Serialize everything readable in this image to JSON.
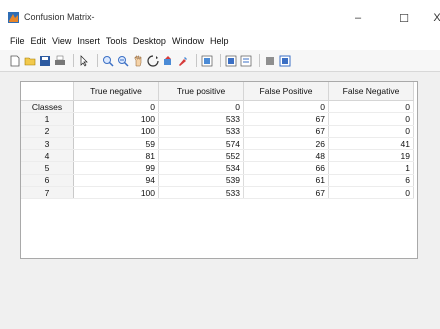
{
  "window": {
    "title": "Confusion Matrix-",
    "minimize": "–",
    "maximize": "☐",
    "close": "X"
  },
  "menu": [
    "File",
    "Edit",
    "View",
    "Insert",
    "Tools",
    "Desktop",
    "Window",
    "Help"
  ],
  "toolbar_icons": [
    "new-figure-icon",
    "open-file-icon",
    "save-icon",
    "print-icon",
    "pointer-icon",
    "zoom-in-icon",
    "zoom-out-icon",
    "pan-icon",
    "rotate-icon",
    "data-cursor-icon",
    "brush-icon",
    "link-plot-icon",
    "colorbar-icon",
    "legend-icon",
    "hide-plot-tools-icon",
    "show-plot-tools-icon"
  ],
  "table": {
    "columns": [
      "True negative",
      "True positive",
      "False Positive",
      "False Negative"
    ],
    "rows": [
      {
        "label": "Classes",
        "values": [
          "0",
          "0",
          "0",
          "0"
        ]
      },
      {
        "label": "1",
        "values": [
          "100",
          "533",
          "67",
          "0"
        ]
      },
      {
        "label": "2",
        "values": [
          "100",
          "533",
          "67",
          "0"
        ]
      },
      {
        "label": "3",
        "values": [
          "59",
          "574",
          "26",
          "41"
        ]
      },
      {
        "label": "4",
        "values": [
          "81",
          "552",
          "48",
          "19"
        ]
      },
      {
        "label": "5",
        "values": [
          "99",
          "534",
          "66",
          "1"
        ]
      },
      {
        "label": "6",
        "values": [
          "94",
          "539",
          "61",
          "6"
        ]
      },
      {
        "label": "7",
        "values": [
          "100",
          "533",
          "67",
          "0"
        ]
      }
    ]
  },
  "colors": {
    "titlebar": "#ffffff",
    "canvas": "#f0f0f0",
    "app_icon_orange": "#e8862a",
    "app_icon_blue": "#2f6db5"
  }
}
